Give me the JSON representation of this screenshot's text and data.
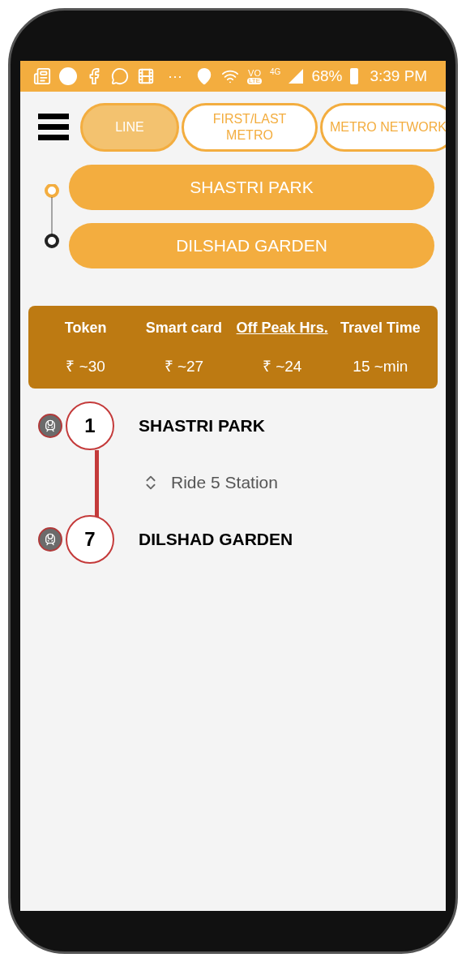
{
  "status_bar": {
    "dots": "···",
    "volte": "VO",
    "lte": "LTE",
    "network": "4G",
    "battery": "68%",
    "time": "3:39 PM"
  },
  "tabs": [
    {
      "label": "LINE",
      "selected": true
    },
    {
      "label": "FIRST/LAST METRO",
      "selected": false
    },
    {
      "label": "METRO NETWORK",
      "selected": false
    }
  ],
  "route": {
    "from": "SHASTRI PARK",
    "to": "DILSHAD GARDEN"
  },
  "fares": [
    {
      "label": "Token",
      "value": "₹ ~30",
      "underlined": false
    },
    {
      "label": "Smart card",
      "value": "₹ ~27",
      "underlined": false
    },
    {
      "label": "Off Peak Hrs.",
      "value": "₹ ~24",
      "underlined": true
    },
    {
      "label": "Travel Time",
      "value": "15 ~min",
      "underlined": false
    }
  ],
  "journey": {
    "stations": [
      {
        "number": "1",
        "name": "SHASTRI PARK"
      },
      {
        "number": "7",
        "name": "DILSHAD GARDEN"
      }
    ],
    "ride": "Ride 5 Station"
  }
}
